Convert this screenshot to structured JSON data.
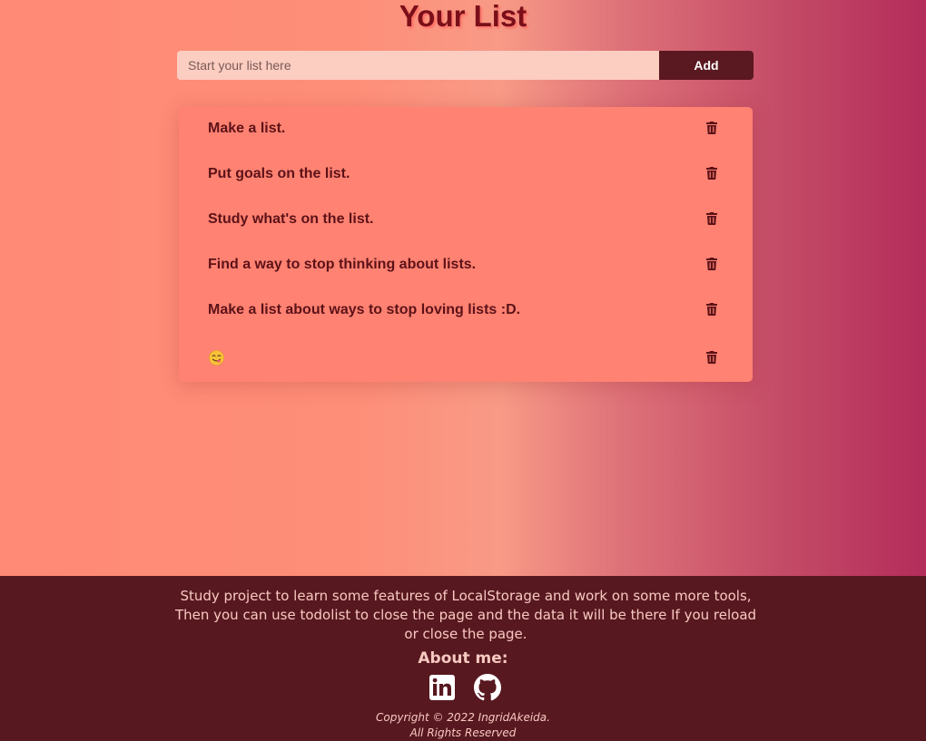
{
  "header": {
    "title": "Your List"
  },
  "form": {
    "placeholder": "Start your list here",
    "value": "",
    "add_label": "Add"
  },
  "todos": [
    {
      "text": "Make a list.",
      "action_icon": "trash-icon"
    },
    {
      "text": "Put goals on the list.",
      "action_icon": "trash-icon"
    },
    {
      "text": "Study what's on the list.",
      "action_icon": "trash-icon"
    },
    {
      "text": "Find a way to stop thinking about lists.",
      "action_icon": "trash-icon"
    },
    {
      "text": "Make a list about ways to stop loving lists :D.",
      "action_icon": "trash-icon"
    },
    {
      "text": "",
      "emoji": "smiling-face-savoring-food",
      "action_icon": "trash-icon"
    }
  ],
  "footer": {
    "description": "Study project to learn some features of LocalStorage and work on some more tools, Then you can use todolist to close the page and the data it will be there If you reload or close the page.",
    "about_heading": "About me:",
    "social": [
      "linkedin-icon",
      "github-icon"
    ],
    "copyright_line1": "Copyright © 2022 IngridAkeida.",
    "copyright_line2": "All Rights Reserved"
  },
  "colors": {
    "title": "#7a0f19",
    "input_bg": "#fccdc1",
    "add_button_bg": "#5a1820",
    "card_bg": "#ff8272",
    "item_text": "#5c1218",
    "footer_bg": "#581820",
    "footer_text": "#f7c9c0"
  }
}
